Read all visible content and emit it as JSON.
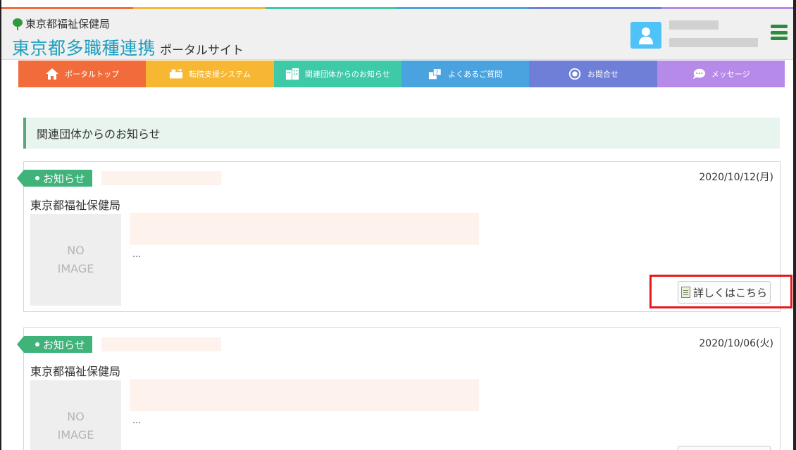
{
  "colors": {
    "stripe": [
      "#f26b3a",
      "#f7b733",
      "#3ec9a7",
      "#4aa3df",
      "#6f7fd8",
      "#b58ae8"
    ],
    "nav": [
      "#f26b3a",
      "#f7b733",
      "#3ec9a7",
      "#4aa3df",
      "#6f7fd8",
      "#b58ae8"
    ],
    "tag": "#3fb37a",
    "highlight": "#e8191c"
  },
  "header": {
    "org": "東京都福祉保健局",
    "title_main": "東京都多職種連携",
    "title_sub": "ポータルサイト"
  },
  "nav": [
    {
      "label": "ポータルトップ",
      "icon": "home-icon"
    },
    {
      "label": "転院支援システム",
      "icon": "transfer-icon"
    },
    {
      "label": "関連団体からのお知らせ",
      "icon": "building-icon"
    },
    {
      "label": "よくあるご質問",
      "icon": "faq-icon"
    },
    {
      "label": "お問合せ",
      "icon": "contact-icon"
    },
    {
      "label": "メッセージ",
      "icon": "message-icon"
    }
  ],
  "section": {
    "heading": "関連団体からのお知らせ"
  },
  "notices": [
    {
      "tag": "お知らせ",
      "date": "2020/10/12(月)",
      "org": "東京都福祉保健局",
      "image_line1": "NO",
      "image_line2": "IMAGE",
      "excerpt": "...",
      "button": "詳しくはこちら"
    },
    {
      "tag": "お知らせ",
      "date": "2020/10/06(火)",
      "org": "東京都福祉保健局",
      "image_line1": "NO",
      "image_line2": "IMAGE",
      "excerpt": "..."
    }
  ]
}
